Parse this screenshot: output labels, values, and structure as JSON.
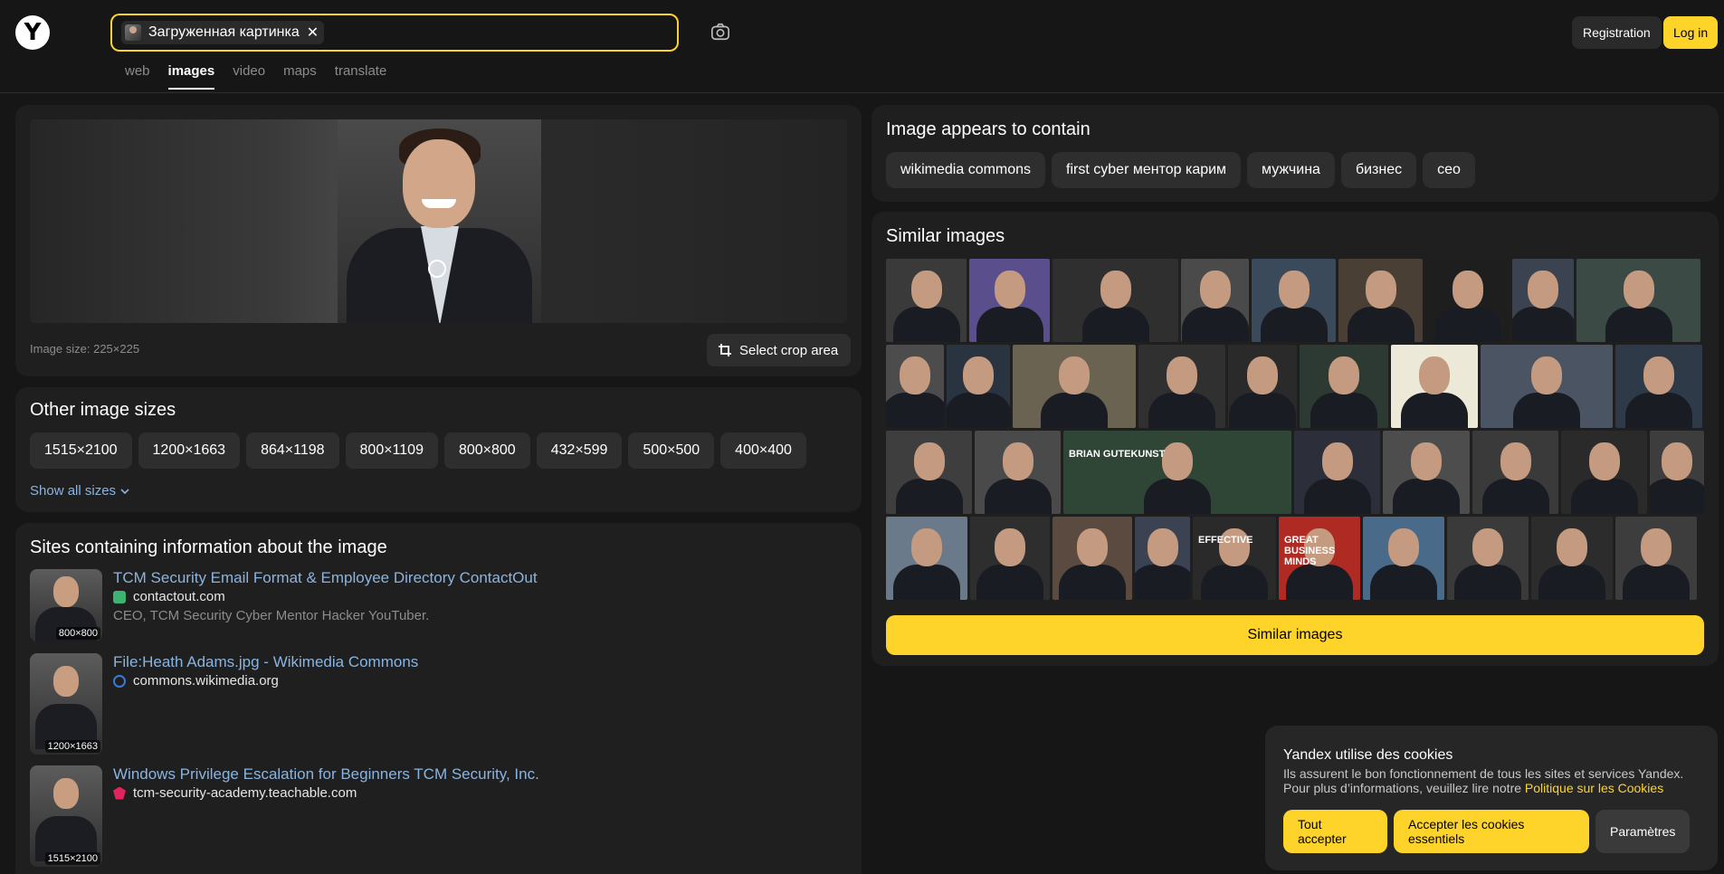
{
  "header": {
    "logo": "Y",
    "search_chip_label": "Загруженная картинка",
    "search_chip_close": "✕",
    "registration": "Registration",
    "login": "Log in",
    "tabs": [
      {
        "label": "web",
        "active": false
      },
      {
        "label": "images",
        "active": true
      },
      {
        "label": "video",
        "active": false
      },
      {
        "label": "maps",
        "active": false
      },
      {
        "label": "translate",
        "active": false
      }
    ]
  },
  "main": {
    "image_size": "Image size: 225×225",
    "crop_label": "Select crop area"
  },
  "other_sizes": {
    "title": "Other image sizes",
    "sizes": [
      "1515×2100",
      "1200×1663",
      "864×1198",
      "800×1109",
      "800×800",
      "432×599",
      "500×500",
      "400×400"
    ],
    "show_all": "Show all sizes"
  },
  "sites": {
    "title": "Sites containing information about the image",
    "items": [
      {
        "title": "TCM Security Email Format & Employee Directory ContactOut",
        "domain": "contactout.com",
        "desc": "CEO, TCM Security Cyber Mentor Hacker YouTuber.",
        "thumb_size": "800×800",
        "favicon_color": "#3cb371"
      },
      {
        "title": "File:Heath Adams.jpg - Wikimedia Commons",
        "domain": "commons.wikimedia.org",
        "desc": "",
        "thumb_size": "1200×1663",
        "favicon_color": "#3a7bd5"
      },
      {
        "title": "Windows Privilege Escalation for Beginners TCM Security, Inc.",
        "domain": "tcm-security-academy.teachable.com",
        "desc": "",
        "thumb_size": "1515×2100",
        "favicon_color": "#e0245e"
      }
    ]
  },
  "contains": {
    "title": "Image appears to contain",
    "tags": [
      "wikimedia commons",
      "first cyber ментор карим",
      "мужчина",
      "бизнес",
      "ceo"
    ]
  },
  "similar": {
    "title": "Similar images",
    "button": "Similar images",
    "rows": [
      [
        {
          "w": 88,
          "bg": "#3a3a3a"
        },
        {
          "w": 88,
          "bg": "#5a4e8c",
          "text": ""
        },
        {
          "w": 138,
          "bg": "#2f2f2f"
        },
        {
          "w": 74,
          "bg": "#4a4a4a"
        },
        {
          "w": 92,
          "bg": "#3b4a5a"
        },
        {
          "w": 92,
          "bg": "#4a3f35"
        },
        {
          "w": 92,
          "bg": "#1e1e1e"
        },
        {
          "w": 68,
          "bg": "#3b4350"
        },
        {
          "w": 136,
          "bg": "#3c4a46"
        }
      ],
      [
        {
          "w": 64,
          "bg": "#4c4c4c"
        },
        {
          "w": 70,
          "bg": "#2a3440"
        },
        {
          "w": 136,
          "bg": "#6a6352"
        },
        {
          "w": 96,
          "bg": "#303030"
        },
        {
          "w": 76,
          "bg": "#2a2a2a"
        },
        {
          "w": 98,
          "bg": "#2d3a33"
        },
        {
          "w": 96,
          "bg": "#ece9d8"
        },
        {
          "w": 146,
          "bg": "#4b5462"
        },
        {
          "w": 96,
          "bg": "#2e3a48"
        }
      ],
      [
        {
          "w": 95,
          "bg": "#3e3e3e"
        },
        {
          "w": 95,
          "bg": "#4a4a4a"
        },
        {
          "w": 252,
          "bg": "#2f4536",
          "text": "BRIAN GUTEKUNST"
        },
        {
          "w": 95,
          "bg": "#2c2f3a"
        },
        {
          "w": 96,
          "bg": "#4d4d4d"
        },
        {
          "w": 95,
          "bg": "#3a3a3a"
        },
        {
          "w": 95,
          "bg": "#2a2a2a"
        },
        {
          "w": 60,
          "bg": "#3d3d3d"
        }
      ],
      [
        {
          "w": 92,
          "bg": "#6a7a8a"
        },
        {
          "w": 90,
          "bg": "#2e2e2e"
        },
        {
          "w": 90,
          "bg": "#5a4a40"
        },
        {
          "w": 62,
          "bg": "#3b4252"
        },
        {
          "w": 94,
          "bg": "#2a2a2a",
          "text": "EFFECTIVE"
        },
        {
          "w": 92,
          "bg": "#b02a24",
          "text": "GREAT BUSINESS MINDS"
        },
        {
          "w": 92,
          "bg": "#4a6a8a"
        },
        {
          "w": 92,
          "bg": "#3a3a3a"
        },
        {
          "w": 92,
          "bg": "#2c2c2c"
        },
        {
          "w": 92,
          "bg": "#3d3d3d"
        }
      ]
    ]
  },
  "cookie": {
    "title": "Yandex utilise des cookies",
    "text": "Ils assurent le bon fonctionnement de tous les sites et services Yandex. Pour plus d’informations, veuillez lire notre ",
    "link": "Politique sur les Cookies",
    "accept_all": "Tout accepter",
    "accept_essential": "Accepter les cookies essentiels",
    "settings": "Paramètres"
  },
  "colors": {
    "accent": "#fed42b",
    "link": "#8ab4e0",
    "background": "#161616",
    "panel": "#1f1f1f"
  }
}
